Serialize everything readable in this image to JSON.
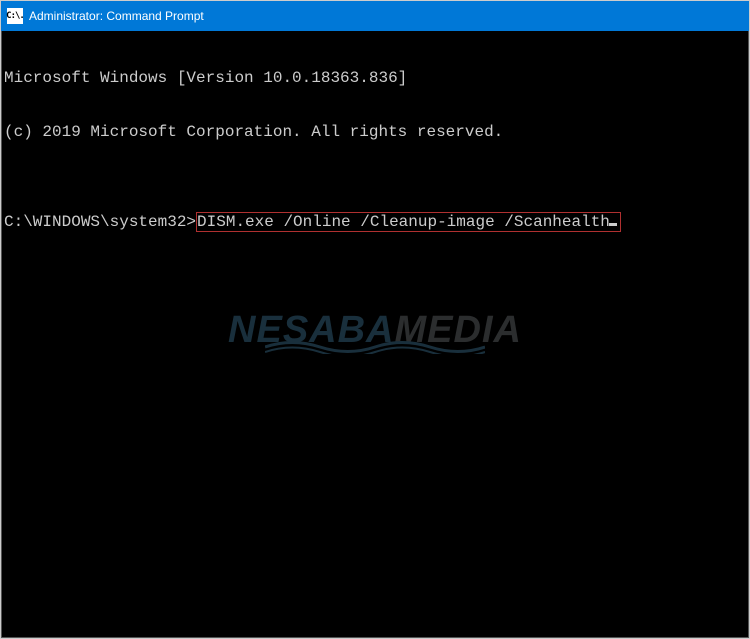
{
  "titlebar": {
    "icon_label": "C:\\.",
    "title": "Administrator: Command Prompt"
  },
  "terminal": {
    "line1": "Microsoft Windows [Version 10.0.18363.836]",
    "line2": "(c) 2019 Microsoft Corporation. All rights reserved.",
    "blank": "",
    "prompt": "C:\\WINDOWS\\system32>",
    "command": "DISM.exe /Online /Cleanup-image /Scanhealth"
  },
  "watermark": {
    "part1": "NESABA",
    "part2": "MEDIA"
  },
  "colors": {
    "titlebar_bg": "#0078d7",
    "terminal_bg": "#000000",
    "terminal_fg": "#cccccc",
    "highlight_border": "#b03030"
  }
}
